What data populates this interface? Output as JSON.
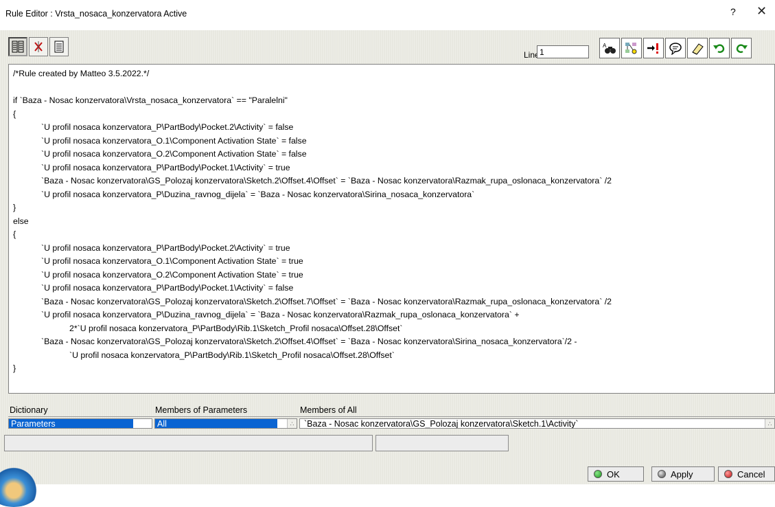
{
  "window": {
    "title": "Rule Editor : Vrsta_nosaca_konzervatora Active",
    "help_glyph": "?",
    "close_glyph": "✕"
  },
  "toolbar": {
    "left_icons": [
      "rule-variables-icon",
      "cancel-x-icon",
      "text-view-icon"
    ],
    "line_label": "Line:",
    "line_value": "1",
    "right_icons": [
      "find-binoculars-icon",
      "object-browser-icon",
      "go-to-error-icon",
      "comment-icon",
      "eraser-icon",
      "undo-icon",
      "redo-icon"
    ]
  },
  "editor": {
    "code": "/*Rule created by Matteo 3.5.2022.*/\n\nif `Baza - Nosac konzervatora\\Vrsta_nosaca_konzervatora` == \"Paralelni\"\n{\n\t\t`U profil nosaca konzervatora_P\\PartBody\\Pocket.2\\Activity` = false\n\t\t`U profil nosaca konzervatora_O.1\\Component Activation State` = false\n\t\t`U profil nosaca konzervatora_O.2\\Component Activation State` = false\n\t\t`U profil nosaca konzervatora_P\\PartBody\\Pocket.1\\Activity` = true\n\t\t`Baza - Nosac konzervatora\\GS_Polozaj konzervatora\\Sketch.2\\Offset.4\\Offset` = `Baza - Nosac konzervatora\\Razmak_rupa_oslonaca_konzervatora` /2\n\t\t`U profil nosaca konzervatora_P\\Duzina_ravnog_dijela` = `Baza - Nosac konzervatora\\Sirina_nosaca_konzervatora`\n}\nelse\n{\n\t\t`U profil nosaca konzervatora_P\\PartBody\\Pocket.2\\Activity` = true\n\t\t`U profil nosaca konzervatora_O.1\\Component Activation State` = true\n\t\t`U profil nosaca konzervatora_O.2\\Component Activation State` = true\n\t\t`U profil nosaca konzervatora_P\\PartBody\\Pocket.1\\Activity` = false\n\t\t`Baza - Nosac konzervatora\\GS_Polozaj konzervatora\\Sketch.2\\Offset.7\\Offset` = `Baza - Nosac konzervatora\\Razmak_rupa_oslonaca_konzervatora` /2\n\t\t`U profil nosaca konzervatora_P\\Duzina_ravnog_dijela` = `Baza - Nosac konzervatora\\Razmak_rupa_oslonaca_konzervatora` +\n\t\t\t\t2*`U profil nosaca konzervatora_P\\PartBody\\Rib.1\\Sketch_Profil nosaca\\Offset.28\\Offset`\n\t\t`Baza - Nosac konzervatora\\GS_Polozaj konzervatora\\Sketch.2\\Offset.4\\Offset` = `Baza - Nosac konzervatora\\Sirina_nosaca_konzervatora`/2 -\n\t\t\t\t`U profil nosaca konzervatora_P\\PartBody\\Rib.1\\Sketch_Profil nosaca\\Offset.28\\Offset`\n}"
  },
  "browser": {
    "dictionary_header": "Dictionary",
    "members_params_header": "Members of Parameters",
    "members_all_header": "Members of All",
    "dictionary_selected": "Parameters",
    "members_params_selected": "All",
    "members_all_first": "`Baza - Nosac konzervatora\\GS_Polozaj konzervatora\\Sketch.1\\Activity`"
  },
  "buttons": {
    "ok": "OK",
    "apply": "Apply",
    "cancel": "Cancel"
  },
  "colors": {
    "selection": "#0a64d2",
    "panel": "#e8e8e0"
  }
}
